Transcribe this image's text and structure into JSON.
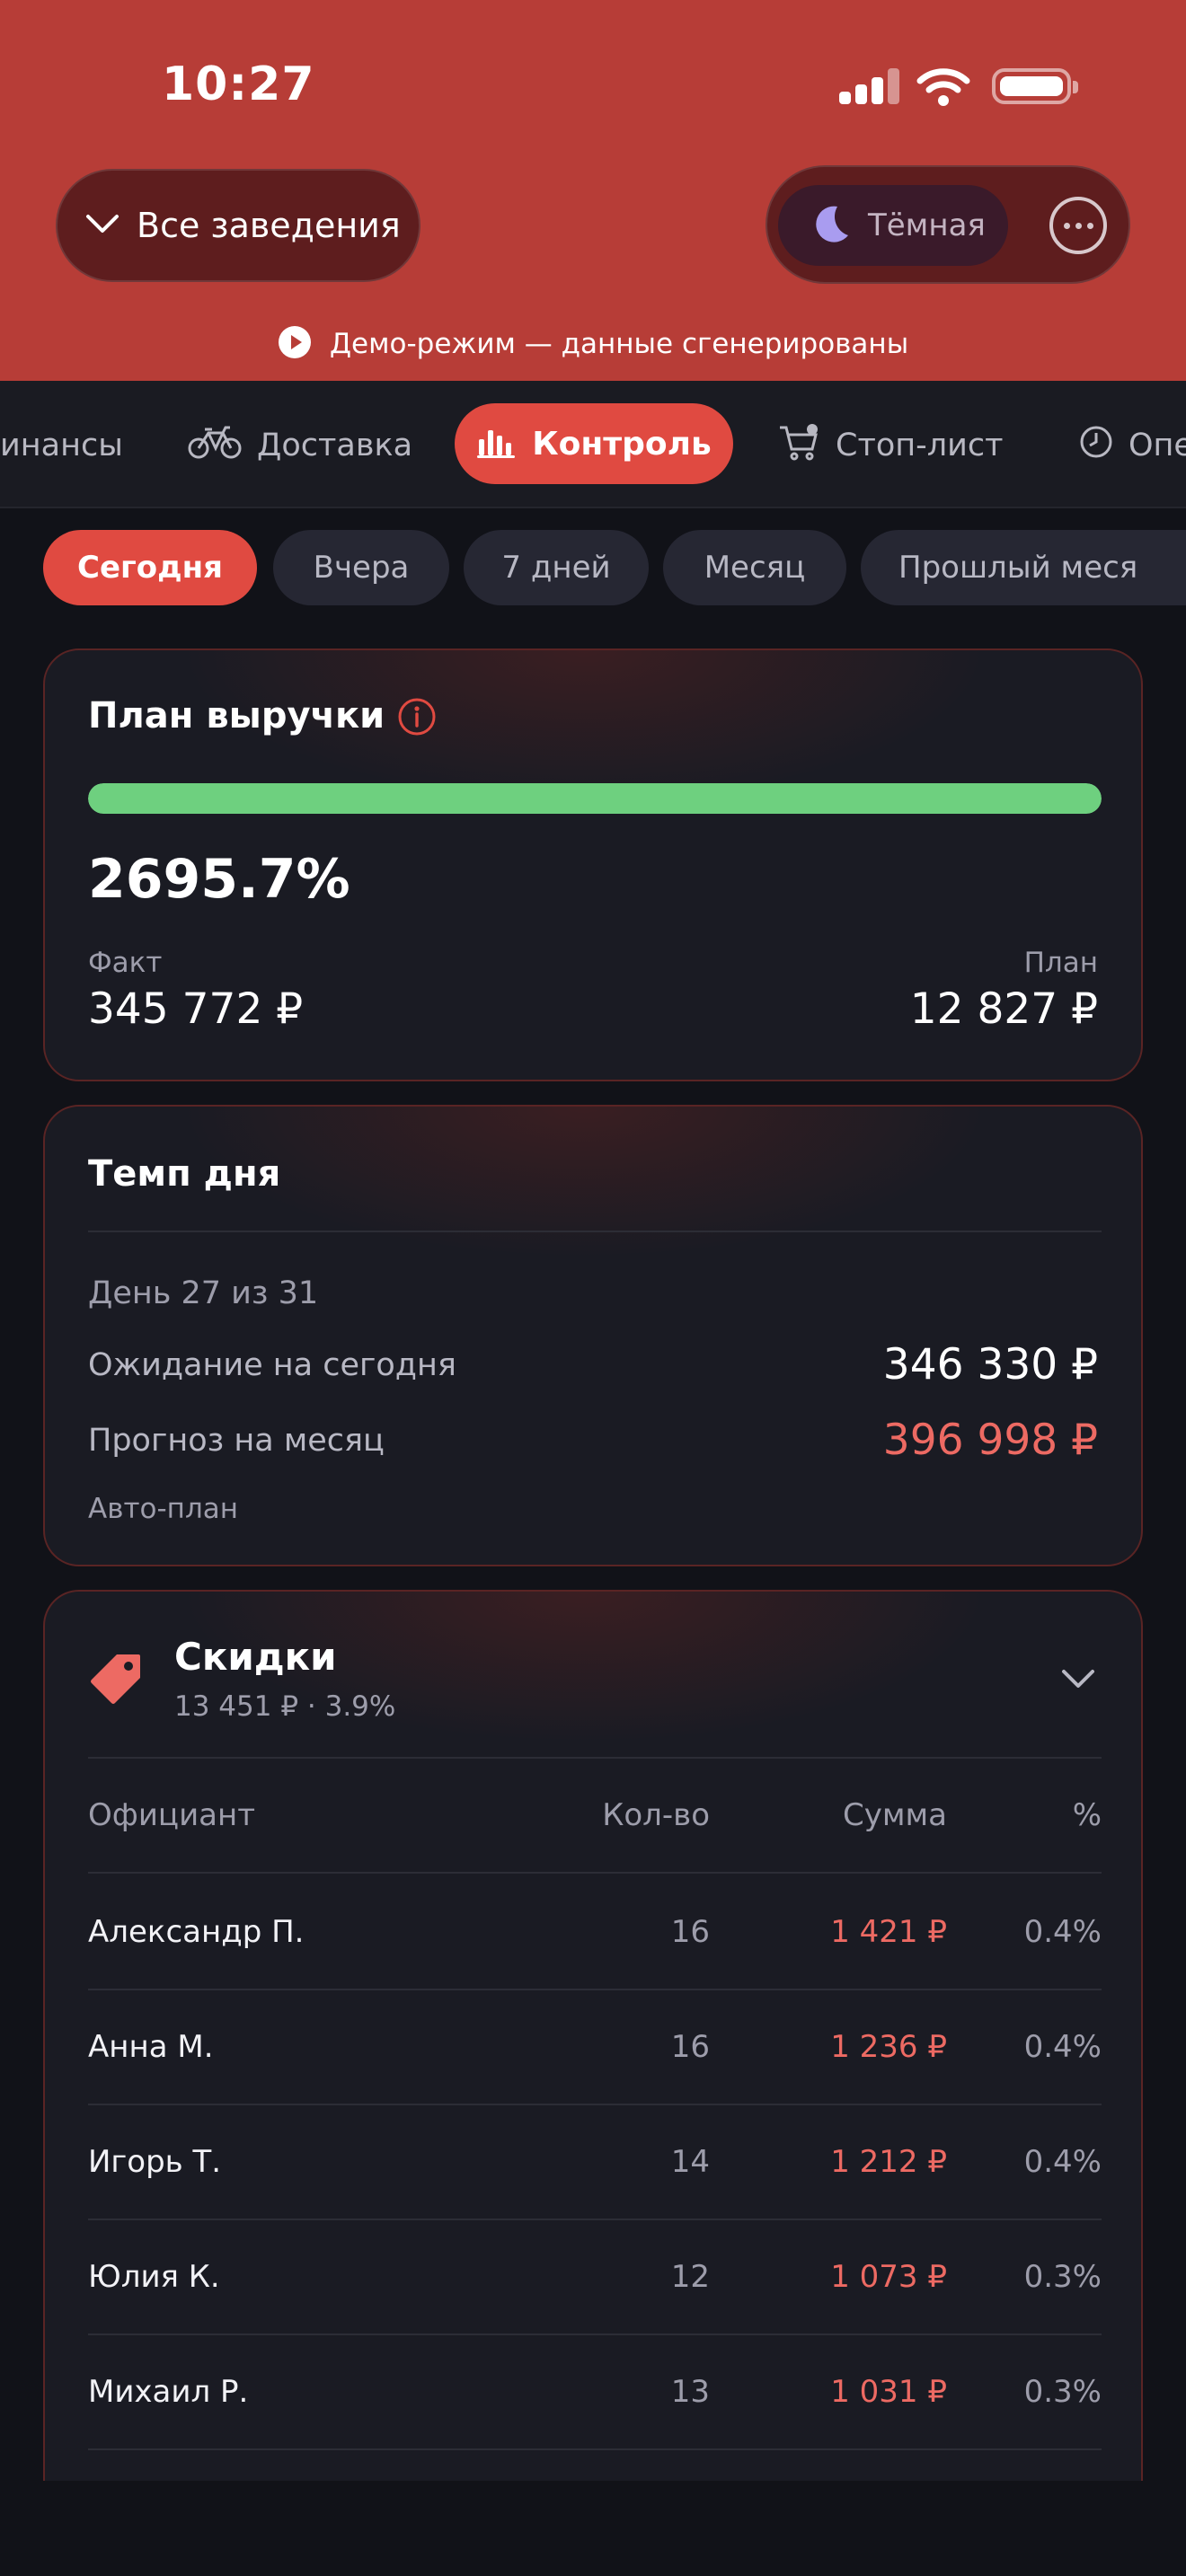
{
  "status_bar": {
    "time": "10:27"
  },
  "header": {
    "venue_selector": "Все заведения",
    "theme_label": "Тёмная",
    "demo_notice": "Демо-режим — данные сгенерированы"
  },
  "nav": {
    "tabs": [
      {
        "id": "finance",
        "label": "инансы",
        "icon": "finance-icon"
      },
      {
        "id": "delivery",
        "label": "Доставка",
        "icon": "bicycle-icon"
      },
      {
        "id": "control",
        "label": "Контроль",
        "icon": "bar-chart-icon",
        "active": true
      },
      {
        "id": "stoplist",
        "label": "Стоп-лист",
        "icon": "cart-icon"
      },
      {
        "id": "ops",
        "label": "Опе",
        "icon": "clock-icon"
      }
    ]
  },
  "periods": {
    "items": [
      "Сегодня",
      "Вчера",
      "7 дней",
      "Месяц",
      "Прошлый меся"
    ],
    "active_index": 0
  },
  "revenue_plan": {
    "title": "План выручки",
    "percent_text": "2695.7%",
    "progress_fraction": 1.0,
    "fact_label": "Факт",
    "fact_value": "345 772 ₽",
    "plan_label": "План",
    "plan_value": "12 827 ₽"
  },
  "day_pace": {
    "title": "Темп дня",
    "day_text": "День 27 из 31",
    "expected_label": "Ожидание на сегодня",
    "expected_value": "346 330 ₽",
    "forecast_label": "Прогноз на месяц",
    "forecast_value": "396 998 ₽",
    "auto_plan": "Авто-план"
  },
  "discounts": {
    "title": "Скидки",
    "subtitle": "13 451 ₽ · 3.9%",
    "columns": {
      "waiter": "Официант",
      "qty": "Кол-во",
      "sum": "Сумма",
      "pct": "%"
    },
    "rows": [
      {
        "name": "Александр П.",
        "qty": "16",
        "sum": "1 421 ₽",
        "pct": "0.4%"
      },
      {
        "name": "Анна М.",
        "qty": "16",
        "sum": "1 236 ₽",
        "pct": "0.4%"
      },
      {
        "name": "Игорь Т.",
        "qty": "14",
        "sum": "1 212 ₽",
        "pct": "0.4%"
      },
      {
        "name": "Юлия К.",
        "qty": "12",
        "sum": "1 073 ₽",
        "pct": "0.3%"
      },
      {
        "name": "Михаил Р.",
        "qty": "13",
        "sum": "1 031 ₽",
        "pct": "0.3%"
      }
    ]
  },
  "colors": {
    "header_bg": "#b73d37",
    "accent": "#e04a41",
    "progress": "#6ed07f",
    "negative": "#ed6a63",
    "background": "#111218"
  }
}
